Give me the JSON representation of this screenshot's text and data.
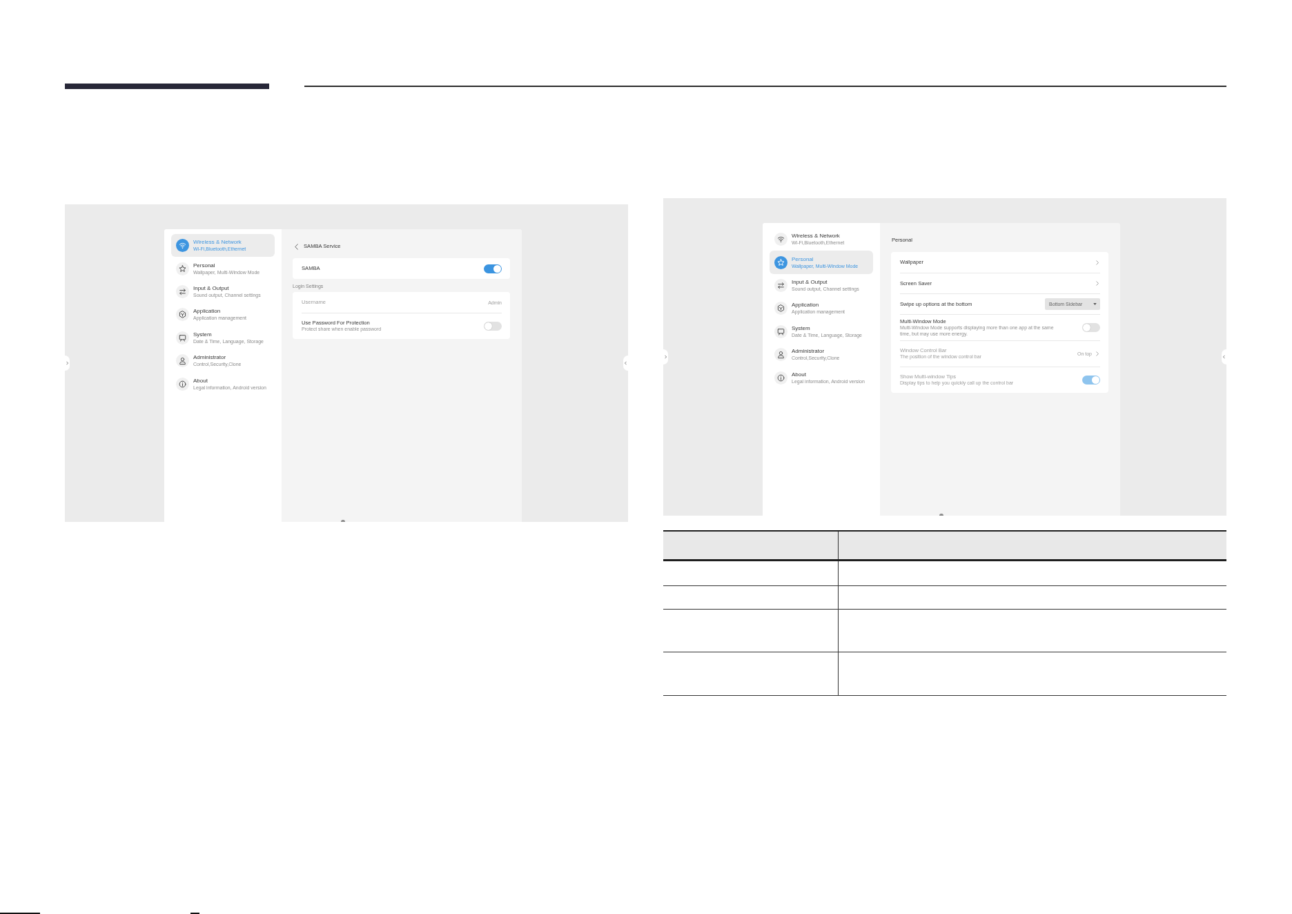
{
  "screens": [
    {
      "sidebar": {
        "items": [
          {
            "title": "Wireless & Network",
            "subtitle": "Wi-Fi,Bluetooth,Ethernet",
            "selected": true
          },
          {
            "title": "Personal",
            "subtitle": "Wallpaper, Multi-Window Mode",
            "selected": false
          },
          {
            "title": "Input & Output",
            "subtitle": "Sound output, Channel settings",
            "selected": false
          },
          {
            "title": "Application",
            "subtitle": "Application management",
            "selected": false
          },
          {
            "title": "System",
            "subtitle": "Date & Time, Language, Storage",
            "selected": false
          },
          {
            "title": "Administrator",
            "subtitle": "Control,Security,Clone",
            "selected": false
          },
          {
            "title": "About",
            "subtitle": "Legal information, Android version",
            "selected": false
          }
        ]
      },
      "page": {
        "title": "SAMBA Service",
        "back": true,
        "sections": [
          {
            "rows": [
              {
                "kind": "toggle",
                "label": "SAMBA",
                "on": true,
                "disabled": false
              }
            ]
          },
          {
            "label": "Login Settings",
            "rows": [
              {
                "kind": "value",
                "label": "Username",
                "value": "Admin",
                "disabled": true
              },
              {
                "kind": "toggle",
                "label": "Use Password For Protection",
                "description": "Protect share when enable password",
                "on": false,
                "disabled": false
              }
            ]
          }
        ]
      }
    },
    {
      "sidebar": {
        "items": [
          {
            "title": "Wireless & Network",
            "subtitle": "Wi-Fi,Bluetooth,Ethernet",
            "selected": false
          },
          {
            "title": "Personal",
            "subtitle": "Wallpaper, Multi-Window Mode",
            "selected": true
          },
          {
            "title": "Input & Output",
            "subtitle": "Sound output, Channel settings",
            "selected": false
          },
          {
            "title": "Application",
            "subtitle": "Application management",
            "selected": false
          },
          {
            "title": "System",
            "subtitle": "Date & Time, Language, Storage",
            "selected": false
          },
          {
            "title": "Administrator",
            "subtitle": "Control,Security,Clone",
            "selected": false
          },
          {
            "title": "About",
            "subtitle": "Legal information, Android version",
            "selected": false
          }
        ]
      },
      "page": {
        "title": "Personal",
        "back": false,
        "sections": [
          {
            "rows": [
              {
                "kind": "link",
                "label": "Wallpaper",
                "disabled": false
              },
              {
                "kind": "link",
                "label": "Screen Saver",
                "disabled": false
              },
              {
                "kind": "dropdown",
                "label": "Swipe up options at the bottom",
                "value": "Bottom Sidebar",
                "disabled": false
              },
              {
                "kind": "toggle",
                "label": "Multi-Window Mode",
                "description": "Multi-Window Mode supports displaying more than one app at the same time, but may use more energy.",
                "on": false,
                "disabled": false
              },
              {
                "kind": "link",
                "label": "Window Control Bar",
                "description": "The position of the window control bar",
                "value": "On top",
                "disabled": true
              },
              {
                "kind": "toggle",
                "label": "Show Multi-window Tips",
                "description": "Display tips to help you quickly call up the control bar",
                "on": true,
                "disabled": true
              }
            ]
          }
        ]
      }
    }
  ]
}
